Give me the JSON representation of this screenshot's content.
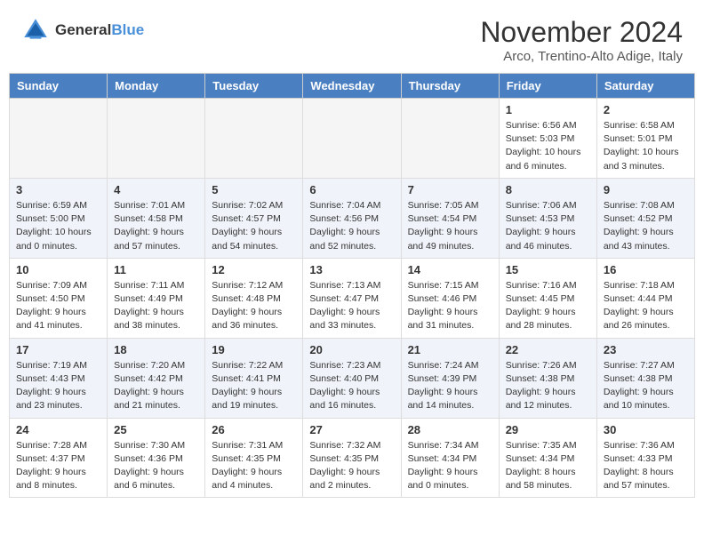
{
  "header": {
    "logo_line1": "General",
    "logo_line2": "Blue",
    "month_title": "November 2024",
    "location": "Arco, Trentino-Alto Adige, Italy"
  },
  "columns": [
    "Sunday",
    "Monday",
    "Tuesday",
    "Wednesday",
    "Thursday",
    "Friday",
    "Saturday"
  ],
  "weeks": [
    [
      {
        "num": "",
        "info": "",
        "empty": true
      },
      {
        "num": "",
        "info": "",
        "empty": true
      },
      {
        "num": "",
        "info": "",
        "empty": true
      },
      {
        "num": "",
        "info": "",
        "empty": true
      },
      {
        "num": "",
        "info": "",
        "empty": true
      },
      {
        "num": "1",
        "info": "Sunrise: 6:56 AM\nSunset: 5:03 PM\nDaylight: 10 hours\nand 6 minutes."
      },
      {
        "num": "2",
        "info": "Sunrise: 6:58 AM\nSunset: 5:01 PM\nDaylight: 10 hours\nand 3 minutes."
      }
    ],
    [
      {
        "num": "3",
        "info": "Sunrise: 6:59 AM\nSunset: 5:00 PM\nDaylight: 10 hours\nand 0 minutes."
      },
      {
        "num": "4",
        "info": "Sunrise: 7:01 AM\nSunset: 4:58 PM\nDaylight: 9 hours\nand 57 minutes."
      },
      {
        "num": "5",
        "info": "Sunrise: 7:02 AM\nSunset: 4:57 PM\nDaylight: 9 hours\nand 54 minutes."
      },
      {
        "num": "6",
        "info": "Sunrise: 7:04 AM\nSunset: 4:56 PM\nDaylight: 9 hours\nand 52 minutes."
      },
      {
        "num": "7",
        "info": "Sunrise: 7:05 AM\nSunset: 4:54 PM\nDaylight: 9 hours\nand 49 minutes."
      },
      {
        "num": "8",
        "info": "Sunrise: 7:06 AM\nSunset: 4:53 PM\nDaylight: 9 hours\nand 46 minutes."
      },
      {
        "num": "9",
        "info": "Sunrise: 7:08 AM\nSunset: 4:52 PM\nDaylight: 9 hours\nand 43 minutes."
      }
    ],
    [
      {
        "num": "10",
        "info": "Sunrise: 7:09 AM\nSunset: 4:50 PM\nDaylight: 9 hours\nand 41 minutes."
      },
      {
        "num": "11",
        "info": "Sunrise: 7:11 AM\nSunset: 4:49 PM\nDaylight: 9 hours\nand 38 minutes."
      },
      {
        "num": "12",
        "info": "Sunrise: 7:12 AM\nSunset: 4:48 PM\nDaylight: 9 hours\nand 36 minutes."
      },
      {
        "num": "13",
        "info": "Sunrise: 7:13 AM\nSunset: 4:47 PM\nDaylight: 9 hours\nand 33 minutes."
      },
      {
        "num": "14",
        "info": "Sunrise: 7:15 AM\nSunset: 4:46 PM\nDaylight: 9 hours\nand 31 minutes."
      },
      {
        "num": "15",
        "info": "Sunrise: 7:16 AM\nSunset: 4:45 PM\nDaylight: 9 hours\nand 28 minutes."
      },
      {
        "num": "16",
        "info": "Sunrise: 7:18 AM\nSunset: 4:44 PM\nDaylight: 9 hours\nand 26 minutes."
      }
    ],
    [
      {
        "num": "17",
        "info": "Sunrise: 7:19 AM\nSunset: 4:43 PM\nDaylight: 9 hours\nand 23 minutes."
      },
      {
        "num": "18",
        "info": "Sunrise: 7:20 AM\nSunset: 4:42 PM\nDaylight: 9 hours\nand 21 minutes."
      },
      {
        "num": "19",
        "info": "Sunrise: 7:22 AM\nSunset: 4:41 PM\nDaylight: 9 hours\nand 19 minutes."
      },
      {
        "num": "20",
        "info": "Sunrise: 7:23 AM\nSunset: 4:40 PM\nDaylight: 9 hours\nand 16 minutes."
      },
      {
        "num": "21",
        "info": "Sunrise: 7:24 AM\nSunset: 4:39 PM\nDaylight: 9 hours\nand 14 minutes."
      },
      {
        "num": "22",
        "info": "Sunrise: 7:26 AM\nSunset: 4:38 PM\nDaylight: 9 hours\nand 12 minutes."
      },
      {
        "num": "23",
        "info": "Sunrise: 7:27 AM\nSunset: 4:38 PM\nDaylight: 9 hours\nand 10 minutes."
      }
    ],
    [
      {
        "num": "24",
        "info": "Sunrise: 7:28 AM\nSunset: 4:37 PM\nDaylight: 9 hours\nand 8 minutes."
      },
      {
        "num": "25",
        "info": "Sunrise: 7:30 AM\nSunset: 4:36 PM\nDaylight: 9 hours\nand 6 minutes."
      },
      {
        "num": "26",
        "info": "Sunrise: 7:31 AM\nSunset: 4:35 PM\nDaylight: 9 hours\nand 4 minutes."
      },
      {
        "num": "27",
        "info": "Sunrise: 7:32 AM\nSunset: 4:35 PM\nDaylight: 9 hours\nand 2 minutes."
      },
      {
        "num": "28",
        "info": "Sunrise: 7:34 AM\nSunset: 4:34 PM\nDaylight: 9 hours\nand 0 minutes."
      },
      {
        "num": "29",
        "info": "Sunrise: 7:35 AM\nSunset: 4:34 PM\nDaylight: 8 hours\nand 58 minutes."
      },
      {
        "num": "30",
        "info": "Sunrise: 7:36 AM\nSunset: 4:33 PM\nDaylight: 8 hours\nand 57 minutes."
      }
    ]
  ]
}
